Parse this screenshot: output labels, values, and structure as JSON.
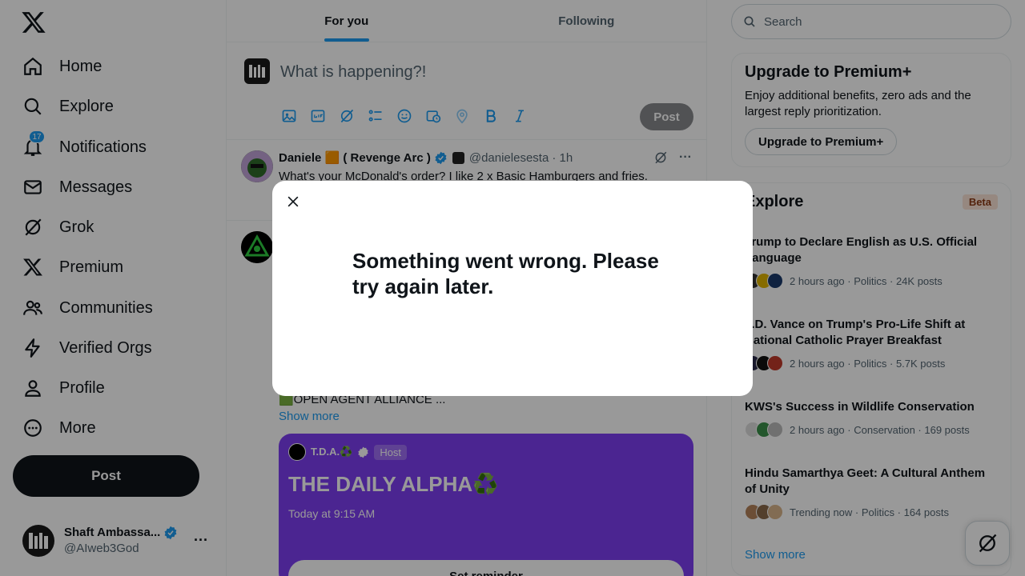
{
  "sidebar": {
    "nav": [
      {
        "label": "Home",
        "icon": "home-icon"
      },
      {
        "label": "Explore",
        "icon": "search-icon"
      },
      {
        "label": "Notifications",
        "icon": "bell-icon",
        "badge": "17"
      },
      {
        "label": "Messages",
        "icon": "mail-icon"
      },
      {
        "label": "Grok",
        "icon": "grok-icon"
      },
      {
        "label": "Premium",
        "icon": "x-logo-icon"
      },
      {
        "label": "Communities",
        "icon": "people-icon"
      },
      {
        "label": "Verified Orgs",
        "icon": "lightning-icon"
      },
      {
        "label": "Profile",
        "icon": "person-icon"
      },
      {
        "label": "More",
        "icon": "more-circle-icon"
      }
    ],
    "post_label": "Post",
    "account": {
      "display_name": "Shaft Ambassa...",
      "handle": "@AIweb3God"
    }
  },
  "main": {
    "tabs": [
      {
        "label": "For you"
      },
      {
        "label": "Following"
      }
    ],
    "composer": {
      "placeholder": "What is happening?!",
      "post_label": "Post"
    },
    "tweet1": {
      "name": "Daniele 🟧 ( Revenge Arc )",
      "handle": "@danielesesta",
      "time": "· 1h",
      "text": "What's your McDonald's order? I like 2 x Basic Hamburgers and fries."
    },
    "tweet2": {
      "fragment": "🟩OPEN AGENT ALLIANCE ...",
      "show_more": "Show more",
      "space": {
        "host_name": "T.D.A.♻️",
        "host_badge": "Host",
        "title": "THE DAILY ALPHA♻️",
        "time": "Today at 9:15 AM",
        "reminder": "Set reminder"
      }
    }
  },
  "right": {
    "search_placeholder": "Search",
    "premium": {
      "title": "Upgrade to Premium+",
      "text": "Enjoy additional benefits, zero ads and the largest reply prioritization.",
      "button": "Upgrade to Premium+"
    },
    "explore": {
      "title": "Explore",
      "badge": "Beta",
      "trends": [
        {
          "title": "Trump to Declare English as U.S. Official Language",
          "meta": "2 hours ago · Politics · 24K posts"
        },
        {
          "title": "J.D. Vance on Trump's Pro-Life Shift at National Catholic Prayer Breakfast",
          "meta": "2 hours ago · Politics · 5.7K posts"
        },
        {
          "title": "KWS's Success in Wildlife Conservation",
          "meta": "2 hours ago · Conservation · 169 posts"
        },
        {
          "title": "Hindu Samarthya Geet: A Cultural Anthem of Unity",
          "meta": "Trending now · Politics · 164 posts"
        }
      ],
      "show_more": "Show more"
    }
  },
  "modal": {
    "message": "Something went wrong. Please try again later."
  },
  "colors": {
    "accent": "#1d9bf0",
    "text": "#0f1419",
    "muted": "#536471",
    "space_bg": "#7e3ff2"
  }
}
